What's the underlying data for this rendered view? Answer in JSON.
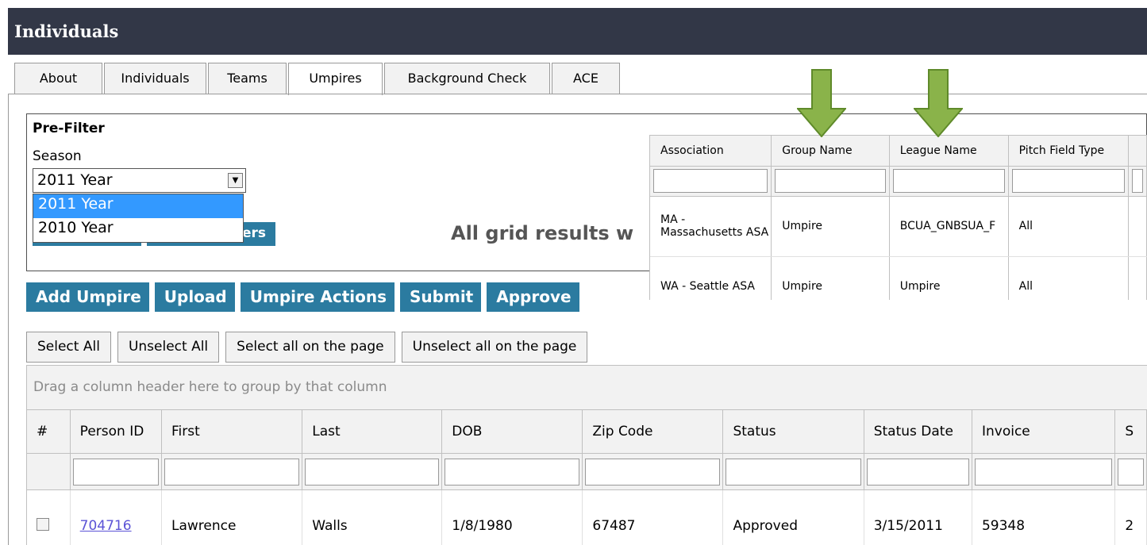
{
  "window": {
    "title": "Individuals"
  },
  "tabs": [
    {
      "label": "About",
      "active": false
    },
    {
      "label": "Individuals",
      "active": false
    },
    {
      "label": "Teams",
      "active": false
    },
    {
      "label": "Umpires",
      "active": true
    },
    {
      "label": "Background Check",
      "active": false
    },
    {
      "label": "ACE",
      "active": false
    }
  ],
  "prefilter": {
    "title": "Pre-Filter",
    "season_label": "Season",
    "season_selected": "2011 Year",
    "season_options": [
      "2011 Year",
      "2010 Year"
    ],
    "hidden_button_suffix": "ers",
    "notice": "All grid results w"
  },
  "popup": {
    "columns": [
      "Association",
      "Group Name",
      "League Name",
      "Pitch Field Type"
    ],
    "rows": [
      {
        "association": "MA - Massachusetts ASA",
        "group": "Umpire",
        "league": "BCUA_GNBSUA_F",
        "pitch": "All"
      },
      {
        "association": "WA - Seattle ASA",
        "group": "Umpire",
        "league": "Umpire",
        "pitch": "All"
      }
    ]
  },
  "actions": [
    "Add Umpire",
    "Upload",
    "Umpire Actions",
    "Submit",
    "Approve"
  ],
  "selection": [
    "Select All",
    "Unselect All",
    "Select all on the page",
    "Unselect all on the page"
  ],
  "grid": {
    "group_hint": "Drag a column header here to group by that column",
    "columns": [
      "#",
      "Person ID",
      "First",
      "Last",
      "DOB",
      "Zip Code",
      "Status",
      "Status Date",
      "Invoice",
      "S"
    ],
    "rows": [
      {
        "person_id": "704716",
        "first": "Lawrence",
        "last": "Walls",
        "dob": "1/8/1980",
        "zip": "67487",
        "status": "Approved",
        "status_date": "3/15/2011",
        "invoice": "59348",
        "extra": "2"
      }
    ]
  },
  "colors": {
    "titlebar": "#323747",
    "button": "#2b7ba0",
    "arrow": "#8ab34a",
    "link": "#5b53d6"
  }
}
